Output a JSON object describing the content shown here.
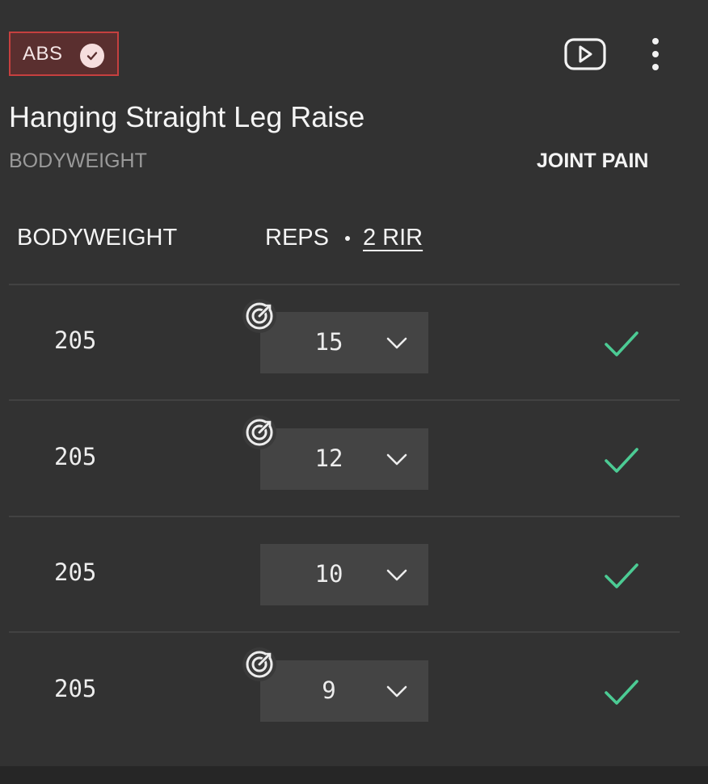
{
  "header": {
    "muscle_tag": "ABS",
    "exercise_title": "Hanging Straight Leg Raise",
    "equipment": "BODYWEIGHT",
    "joint_pain_label": "JOINT PAIN"
  },
  "columns": {
    "weight_header": "BODYWEIGHT",
    "reps_header": "REPS",
    "rir_label": "2 RIR"
  },
  "sets": [
    {
      "weight": "205",
      "reps": "15",
      "has_target": true,
      "completed": true
    },
    {
      "weight": "205",
      "reps": "12",
      "has_target": true,
      "completed": true
    },
    {
      "weight": "205",
      "reps": "10",
      "has_target": false,
      "completed": true
    },
    {
      "weight": "205",
      "reps": "9",
      "has_target": true,
      "completed": true
    }
  ],
  "colors": {
    "background": "#323232",
    "tag_background": "#5a2f2f",
    "tag_border": "#c6403f",
    "check_green": "#4ccb94",
    "reps_box": "#444444"
  },
  "icons": {
    "tag_status": "check-circle-icon",
    "video": "video-play-icon",
    "menu": "more-vertical-icon",
    "dropdown": "chevron-down-icon",
    "target": "target-icon",
    "completed": "checkmark-icon"
  }
}
